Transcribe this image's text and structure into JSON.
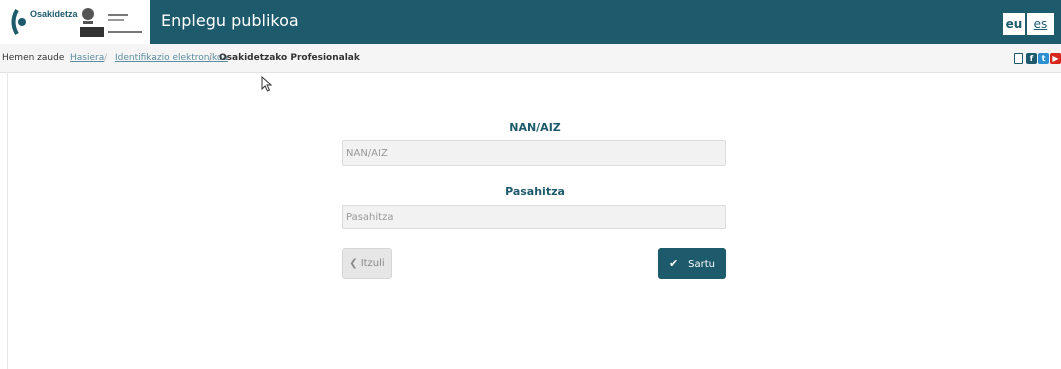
{
  "header": {
    "org_name": "Osakidetza",
    "gov_seal_text": "EUSKO JAURLARITZA · OSASUN SAILA · GOBIERNO VASCO · DEPARTAMENTO DE SALUD",
    "title": "Enplegu publikoa",
    "lang_eu": "eu",
    "lang_es": "es",
    "brand_color": "#1d5a6c"
  },
  "breadcrumb": {
    "prefix": "Hemen zaude",
    "items": [
      "Hasiera",
      "Identifikazio elektronikoa",
      "Osakidetzako Profesionalak"
    ],
    "separator": "/"
  },
  "social": [
    "mobile-icon",
    "facebook-icon",
    "twitter-icon",
    "youtube-icon"
  ],
  "form": {
    "user_label": "NAN/AIZ",
    "user_placeholder": "NAN/AIZ",
    "user_value": "",
    "pass_label": "Pasahitza",
    "pass_placeholder": "Pasahitza",
    "pass_value": "",
    "back_label": "Itzuli",
    "submit_label": "Sartu"
  }
}
